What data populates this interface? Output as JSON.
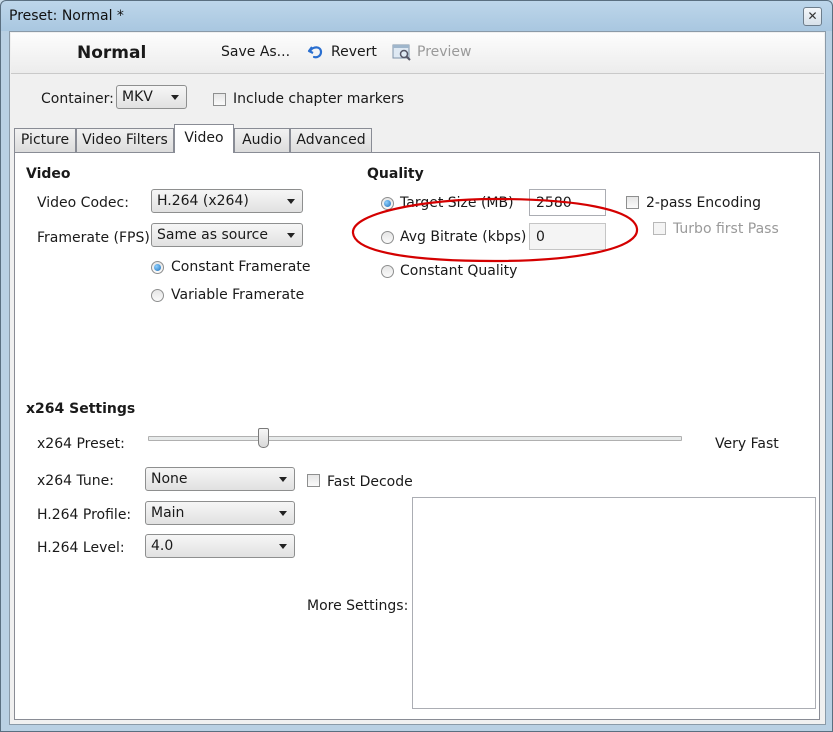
{
  "window": {
    "title": "Preset: Normal *"
  },
  "toolbar": {
    "preset_name": "Normal",
    "save_as": "Save As...",
    "revert": "Revert",
    "preview": "Preview"
  },
  "container": {
    "label": "Container:",
    "value": "MKV",
    "chapter_markers_label": "Include chapter markers",
    "chapter_markers_checked": false
  },
  "tabs": [
    {
      "label": "Picture",
      "active": false
    },
    {
      "label": "Video Filters",
      "active": false
    },
    {
      "label": "Video",
      "active": true
    },
    {
      "label": "Audio",
      "active": false
    },
    {
      "label": "Advanced",
      "active": false
    }
  ],
  "video": {
    "heading": "Video",
    "codec_label": "Video Codec:",
    "codec_value": "H.264 (x264)",
    "framerate_label": "Framerate (FPS):",
    "framerate_value": "Same as source",
    "constant_fr": "Constant Framerate",
    "variable_fr": "Variable Framerate",
    "selected_framerate_mode": "Constant Framerate"
  },
  "quality": {
    "heading": "Quality",
    "target_size_label": "Target Size (MB)",
    "target_size_value": "2580",
    "avg_bitrate_label": "Avg Bitrate (kbps)",
    "avg_bitrate_value": "0",
    "constant_quality_label": "Constant Quality",
    "selected_mode": "Target Size (MB)",
    "two_pass_label": "2-pass Encoding",
    "two_pass_checked": false,
    "turbo_label": "Turbo first Pass",
    "turbo_checked": false,
    "annotation_color": "#d40000"
  },
  "x264": {
    "heading": "x264 Settings",
    "preset_label": "x264 Preset:",
    "preset_value": "Very Fast",
    "tune_label": "x264 Tune:",
    "tune_value": "None",
    "fast_decode_label": "Fast Decode",
    "fast_decode_checked": false,
    "profile_label": "H.264 Profile:",
    "profile_value": "Main",
    "level_label": "H.264 Level:",
    "level_value": "4.0",
    "more_settings_label": "More Settings:",
    "more_settings_value": ""
  },
  "icons": {
    "revert": "undo-arrow-icon",
    "preview": "preview-window-icon",
    "close": "close-icon"
  }
}
